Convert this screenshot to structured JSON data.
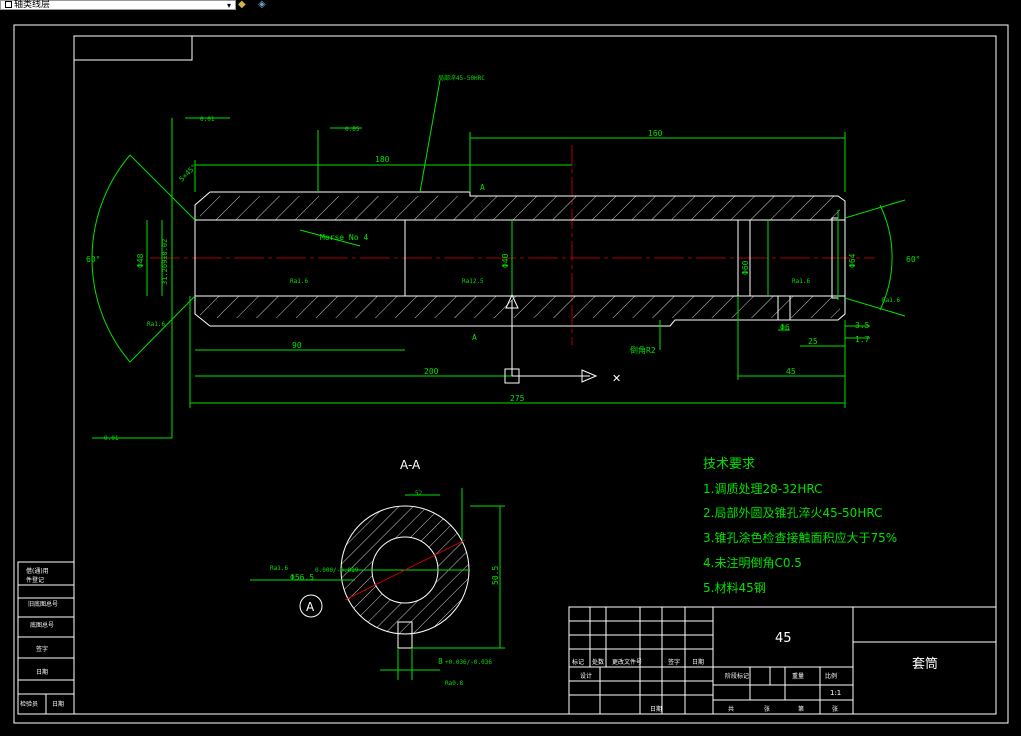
{
  "toolbar": {
    "layer_name": "轴类线层",
    "icons": [
      "layer-properties-icon",
      "layer-states-icon"
    ]
  },
  "drawing": {
    "dims": {
      "d_160_top": "160",
      "d_180": "180",
      "d_90": "90",
      "d_200": "200",
      "d_275": "275",
      "d_45": "45",
      "d_25": "25",
      "d_3_5": "3.5",
      "d_1_7": "1.7",
      "d_6": "Φ6",
      "d_48": "Φ48",
      "d_31_269": "31.269±0.02",
      "d_60_left": "60°",
      "d_60_right": "60°",
      "d_64": "Φ64",
      "d_60_bore": "Φ60",
      "d_40_inner": "Φ40",
      "morse": "Morse No 4",
      "chamfer": "5×45°",
      "fillet": "倒角R2",
      "section_a": "A",
      "hardening": "局部淬45-50HRC",
      "tol_top": "0.01",
      "tol_mid": "0.05",
      "tol_bottom": "0.01",
      "ra_1": "Ra1.6",
      "ra_2": "Ra1.6",
      "ra_3": "Ra12.5",
      "ra_4": "Ra1.6",
      "ra_5": "Ra1.6",
      "ra_6": "Ra1.6"
    },
    "section": {
      "title": "A-A",
      "d_56": "Φ56.5",
      "d_56_tol": "0.000/-0.019",
      "d_52": "52",
      "d_50": "50.5",
      "key": "8",
      "key_tol": "+0.036/-0.036",
      "ra_a": "Ra1.6",
      "ra_b": "Ra0.8",
      "datum": "A"
    },
    "tech_requirements": {
      "title": "技术要求",
      "items": [
        "1.调质处理28-32HRC",
        "2.局部外圆及锥孔淬火45-50HRC",
        "3.锥孔涂色检查接触面积应大于75%",
        "4.未注明倒角C0.5",
        "5.材料45钢"
      ]
    },
    "title_block": {
      "material": "45",
      "part_name": "套筒",
      "scale": "1:1",
      "header_labels": [
        "标记",
        "处数",
        "更改文件号",
        "签字",
        "日期"
      ],
      "row_labels": [
        "设计",
        "",
        "",
        "",
        "",
        "日期"
      ],
      "mid_labels": [
        "阶段标记",
        "重量",
        "比例"
      ],
      "bottom_labels": [
        "共",
        "张",
        "第",
        "张"
      ]
    },
    "side_table": {
      "rows": [
        "借(通)用",
        "件登记",
        "旧底图总号",
        "底图总号",
        "签字",
        "日期",
        "检验员",
        "日期"
      ]
    }
  }
}
